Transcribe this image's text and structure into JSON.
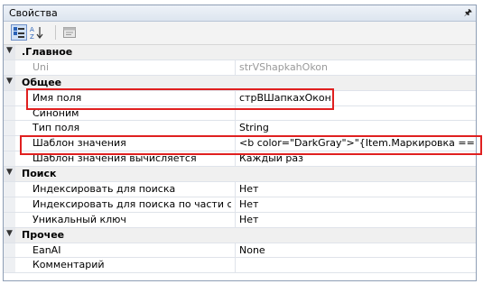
{
  "panel": {
    "title": "Свойства",
    "pin_icon": "pin-icon"
  },
  "toolbar": {
    "buttons": [
      {
        "name": "categorized-view-button",
        "icon": "categorized-icon",
        "active": true
      },
      {
        "name": "alphabetical-sort-button",
        "icon": "sort-az-icon",
        "active": false
      },
      {
        "name": "property-pages-button",
        "icon": "property-pages-icon",
        "active": false
      }
    ]
  },
  "categories": {
    "main": {
      "label": ".Главное"
    },
    "general": {
      "label": "Общее"
    },
    "search": {
      "label": "Поиск"
    },
    "other": {
      "label": "Прочее"
    }
  },
  "rows": {
    "uni": {
      "name": "Uni",
      "value": "strVShapkahOkon"
    },
    "field_name": {
      "name": "Имя поля",
      "value": "стрВШапкахОкон"
    },
    "synonym": {
      "name": "Синоним",
      "value": ""
    },
    "field_type": {
      "name": "Тип поля",
      "value": "String"
    },
    "value_template": {
      "name": "Шаблон значения",
      "value": "<b color=\"DarkGray\">\"{Item.Маркировка ==\"Обувь"
    },
    "template_computed": {
      "name": "Шаблон значения вычисляется",
      "value": "Каждый раз"
    },
    "index_search": {
      "name": "Индексировать для поиска",
      "value": "Нет"
    },
    "index_partial": {
      "name": "Индексировать для поиска по части строки",
      "value": "Нет"
    },
    "unique_key": {
      "name": "Уникальный ключ",
      "value": "Нет"
    },
    "eanai": {
      "name": "EanAI",
      "value": "None"
    },
    "comment": {
      "name": "Комментарий",
      "value": ""
    }
  },
  "colors": {
    "highlight": "#e02020",
    "header": "#dde5ef",
    "category": "#f0f0f0"
  }
}
